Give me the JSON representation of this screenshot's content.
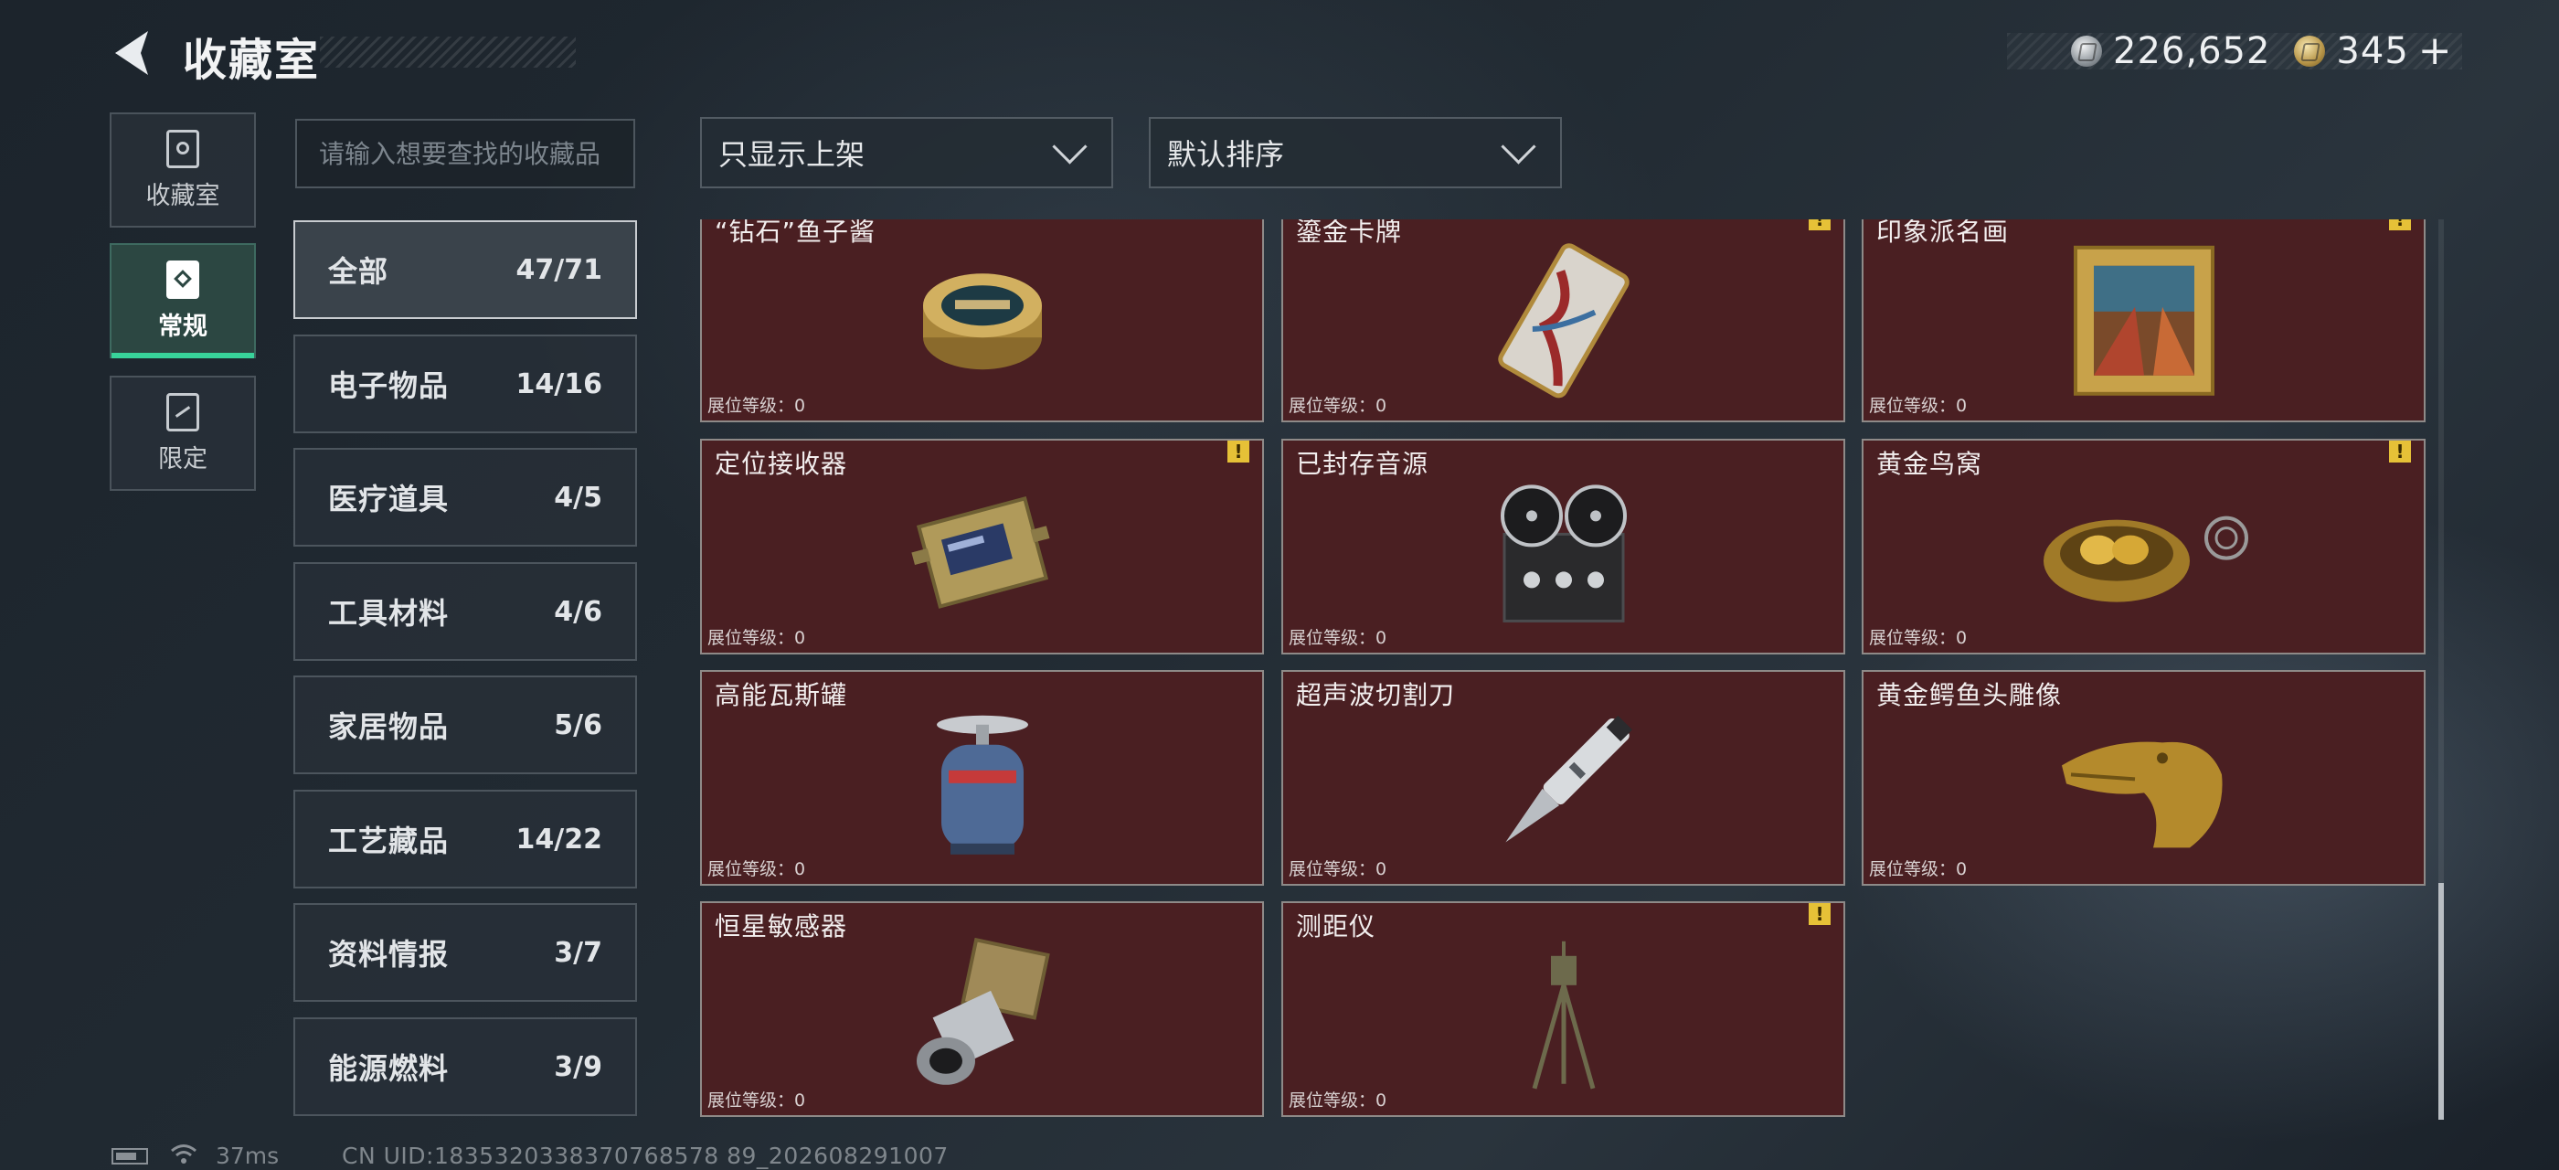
{
  "header": {
    "title": "收藏室"
  },
  "currency": {
    "silver_value": "226,652",
    "gold_value": "345",
    "plus_label": "+"
  },
  "side_tabs": [
    {
      "label": "收藏室",
      "icon": "vault-icon",
      "active": false
    },
    {
      "label": "常规",
      "icon": "regular-collection-icon",
      "active": true
    },
    {
      "label": "限定",
      "icon": "limited-collection-icon",
      "active": false
    }
  ],
  "search": {
    "placeholder": "请输入想要查找的收藏品",
    "value": ""
  },
  "filters": {
    "display": "只显示上架",
    "sort": "默认排序"
  },
  "categories": [
    {
      "name": "全部",
      "count": "47/71",
      "active": true
    },
    {
      "name": "电子物品",
      "count": "14/16"
    },
    {
      "name": "医疗道具",
      "count": "4/5"
    },
    {
      "name": "工具材料",
      "count": "4/6"
    },
    {
      "name": "家居物品",
      "count": "5/6"
    },
    {
      "name": "工艺藏品",
      "count": "14/22"
    },
    {
      "name": "资料情报",
      "count": "3/7"
    },
    {
      "name": "能源燃料",
      "count": "3/9"
    }
  ],
  "items": [
    {
      "name": "“钻石”鱼子酱",
      "level": "展位等级：0",
      "alert": false,
      "icon": "caviar-tin-icon"
    },
    {
      "name": "鎏金卡牌",
      "level": "展位等级：0",
      "alert": true,
      "alert_mark": "!",
      "icon": "gilded-card-icon"
    },
    {
      "name": "印象派名画",
      "level": "展位等级：0",
      "alert": true,
      "alert_mark": "!",
      "icon": "framed-painting-icon"
    },
    {
      "name": "定位接收器",
      "level": "展位等级：0",
      "alert": true,
      "alert_mark": "!",
      "icon": "locator-receiver-icon"
    },
    {
      "name": "已封存音源",
      "level": "展位等级：0",
      "alert": false,
      "icon": "reel-to-reel-recorder-icon"
    },
    {
      "name": "黄金鸟窝",
      "level": "展位等级：0",
      "alert": true,
      "alert_mark": "!",
      "icon": "golden-nest-icon"
    },
    {
      "name": "高能瓦斯罐",
      "level": "展位等级：0",
      "alert": false,
      "icon": "gas-canister-icon"
    },
    {
      "name": "超声波切割刀",
      "level": "展位等级：0",
      "alert": false,
      "icon": "ultrasonic-cutter-icon"
    },
    {
      "name": "黄金鳄鱼头雕像",
      "level": "展位等级：0",
      "alert": false,
      "icon": "golden-crocodile-head-icon"
    },
    {
      "name": "恒星敏感器",
      "level": "展位等级：0",
      "alert": false,
      "icon": "star-sensor-icon"
    },
    {
      "name": "测距仪",
      "level": "展位等级：0",
      "alert": true,
      "alert_mark": "!",
      "icon": "rangefinder-tripod-icon"
    }
  ],
  "footer": {
    "ping": "37ms",
    "uid": "CN UID:1835320338370768578 89_202608291007"
  },
  "colors": {
    "card_bg": "#4a1f22",
    "active_tab": "#38d39a",
    "alert": "#e6c137"
  }
}
